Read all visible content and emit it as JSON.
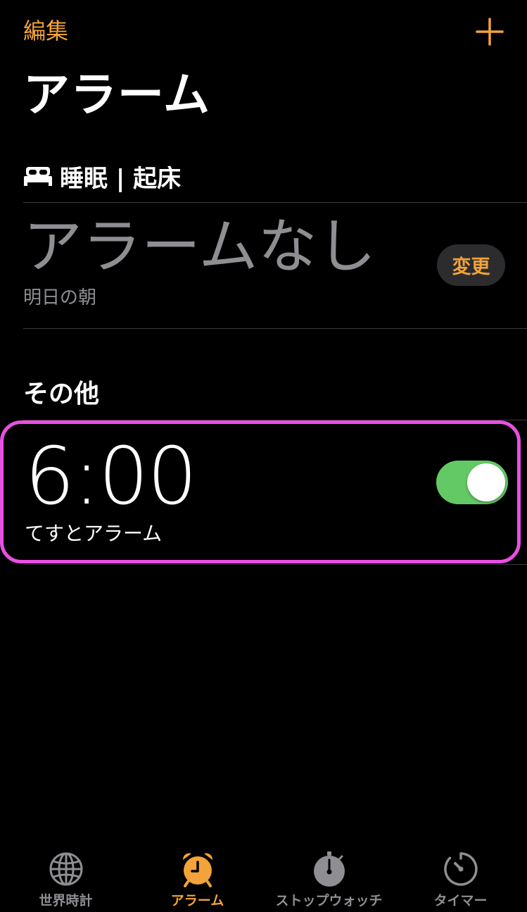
{
  "header": {
    "edit_label": "編集",
    "add_icon": "plus-icon",
    "title": "アラーム"
  },
  "sleep": {
    "icon": "bed-icon",
    "title": "睡眠 | 起床",
    "no_alarm": "アラームなし",
    "subtitle": "明日の朝",
    "change_label": "変更"
  },
  "other": {
    "title": "その他",
    "alarms": [
      {
        "time": "6:00",
        "label": "てすとアラーム",
        "enabled": true
      }
    ]
  },
  "tabs": [
    {
      "label": "世界時計",
      "icon": "globe-icon",
      "active": false
    },
    {
      "label": "アラーム",
      "icon": "alarm-clock-icon",
      "active": true
    },
    {
      "label": "ストップウォッチ",
      "icon": "stopwatch-icon",
      "active": false
    },
    {
      "label": "タイマー",
      "icon": "timer-icon",
      "active": false
    }
  ],
  "colors": {
    "accent": "#F2A33A",
    "toggle_on": "#63C964",
    "highlight": "#E94FE3",
    "secondary_text": "#8E8E93"
  }
}
